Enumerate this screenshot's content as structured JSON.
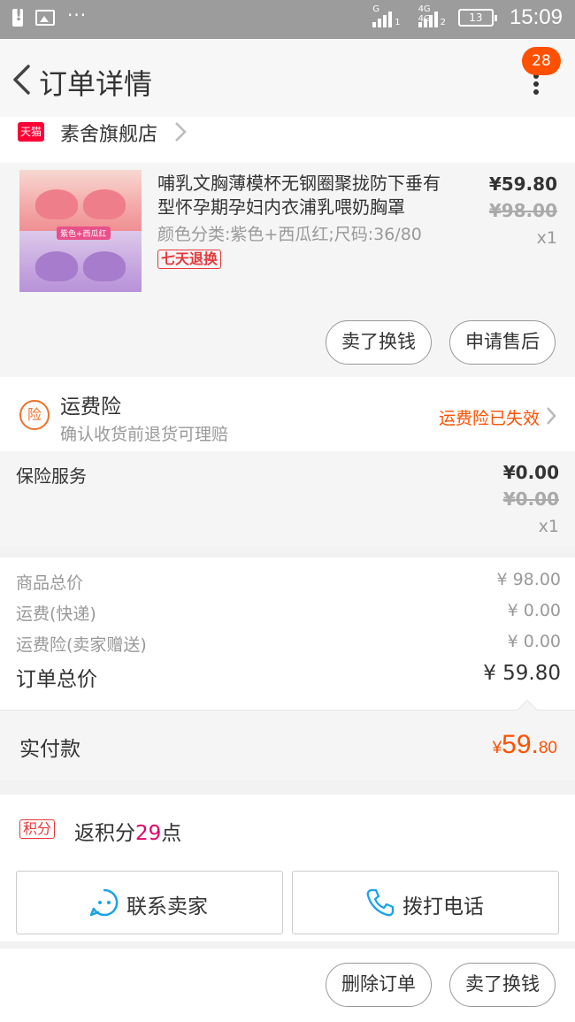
{
  "status_bar": {
    "time": "15:09",
    "battery": "13",
    "dots": "···",
    "sig1_label": "G",
    "sig1_sub": "1",
    "sig2_label": "4G 4G",
    "sig2_sub": "2"
  },
  "header": {
    "title": "订单详情",
    "badge": "28"
  },
  "store": {
    "icon_label": "天猫",
    "name": "素舍旗舰店"
  },
  "product": {
    "title": "哺乳文胸薄模杯无钢圈聚拢防下垂有型怀孕期孕妇内衣浦乳喂奶胸罩",
    "spec": "颜色分类:紫色+西瓜红;尺码:36/80",
    "return_badge": "七天退换",
    "price": "¥59.80",
    "original_price": "¥98.00",
    "quantity": "x1",
    "image_tag": "紫色+西瓜红",
    "actions": [
      "卖了换钱",
      "申请售后"
    ]
  },
  "insurance": {
    "icon_label": "险",
    "title": "运费险",
    "subtitle": "确认收货前退货可理赔",
    "status": "运费险已失效"
  },
  "service": {
    "name": "保险服务",
    "price": "¥0.00",
    "original_price": "¥0.00",
    "quantity": "x1"
  },
  "summary": {
    "rows": [
      {
        "label": "商品总价",
        "value": "¥ 98.00"
      },
      {
        "label": "运费(快递)",
        "value": "¥ 0.00"
      },
      {
        "label": "运费险(卖家赠送)",
        "value": "¥ 0.00"
      }
    ],
    "total_label": "订单总价",
    "total_value": "¥ 59.80"
  },
  "paid": {
    "label": "实付款",
    "currency": "¥",
    "integer": "59.",
    "decimal": "80"
  },
  "points": {
    "badge": "积分",
    "text_prefix": "返积分",
    "amount": "29",
    "text_suffix": "点"
  },
  "contact": {
    "seller": "联系卖家",
    "phone": "拨打电话"
  },
  "bottom_actions": [
    "删除订单",
    "卖了换钱"
  ],
  "colors": {
    "accent": "#ff5000",
    "red": "#e4393c",
    "tmall": "#ff0036",
    "icon_blue": "#1aa3e8"
  }
}
